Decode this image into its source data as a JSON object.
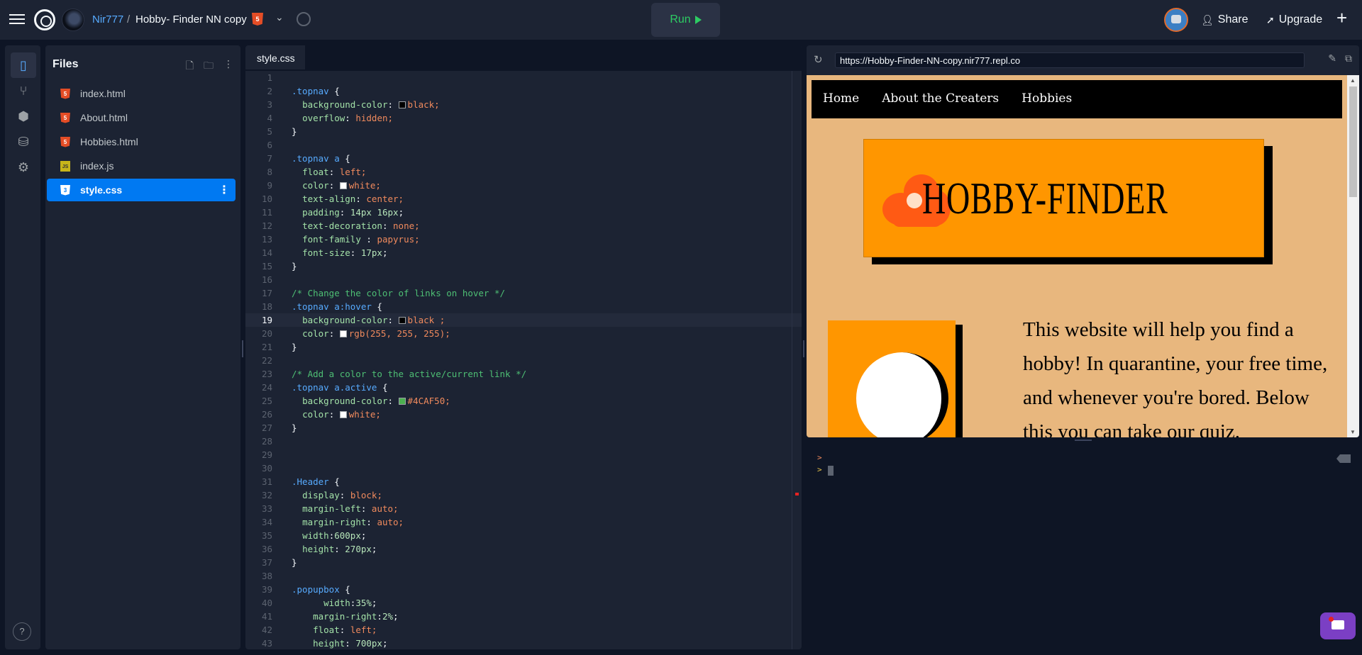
{
  "header": {
    "username": "Nir777",
    "separator": "/",
    "repl_name": "Hobby- Finder NN copy",
    "language_badge": "5",
    "run_label": "Run",
    "share_label": "Share",
    "upgrade_label": "Upgrade",
    "plus": "+"
  },
  "colors": {
    "accent": "#0079f2",
    "run_green": "#2dcc63",
    "background": "#0e1525",
    "panel": "#1c2333"
  },
  "rail": {
    "icons": [
      "files-icon",
      "git-icon",
      "packages-icon",
      "database-icon",
      "settings-icon"
    ],
    "help": "?"
  },
  "files_panel": {
    "title": "Files",
    "items": [
      {
        "name": "index.html",
        "type": "html"
      },
      {
        "name": "About.html",
        "type": "html"
      },
      {
        "name": "Hobbies.html",
        "type": "html"
      },
      {
        "name": "index.js",
        "type": "js"
      },
      {
        "name": "style.css",
        "type": "css",
        "active": true
      }
    ]
  },
  "editor": {
    "tab": "style.css",
    "current_line": 19,
    "lines": [
      "",
      ".topnav {",
      "  background-color: black;",
      "  overflow: hidden;",
      "}",
      "",
      ".topnav a {",
      "  float: left;",
      "  color: white;",
      "  text-align: center;",
      "  padding: 14px 16px;",
      "  text-decoration: none;",
      "  font-family : papyrus;",
      "  font-size: 17px;",
      "}",
      "",
      "/* Change the color of links on hover */",
      ".topnav a:hover {",
      "  background-color: black ;",
      "  color: rgb(255, 255, 255);",
      "}",
      "",
      "/* Add a color to the active/current link */",
      ".topnav a.active {",
      "  background-color: #4CAF50;",
      "  color: white;",
      "}",
      "",
      "",
      "",
      ".Header {",
      "  display: block;",
      "  margin-left: auto;",
      "  margin-right: auto;",
      "  width:600px;",
      "  height: 270px;",
      "}",
      "",
      ".popupbox {",
      "      width:35%;",
      "    margin-right:2%;",
      "    float: left;",
      "    height: 700px;"
    ]
  },
  "preview": {
    "url": "https://Hobby-Finder-NN-copy.nir777.repl.co",
    "nav": [
      "Home",
      "About the Creaters",
      "Hobbies"
    ],
    "banner_title": "HOBBY-FINDER",
    "paragraph": "This website will help you find a hobby! In quarantine, your free time, and whenever you're bored. Below this you can take our quiz."
  },
  "console": {
    "prompt1": ">",
    "prompt2": ">"
  }
}
